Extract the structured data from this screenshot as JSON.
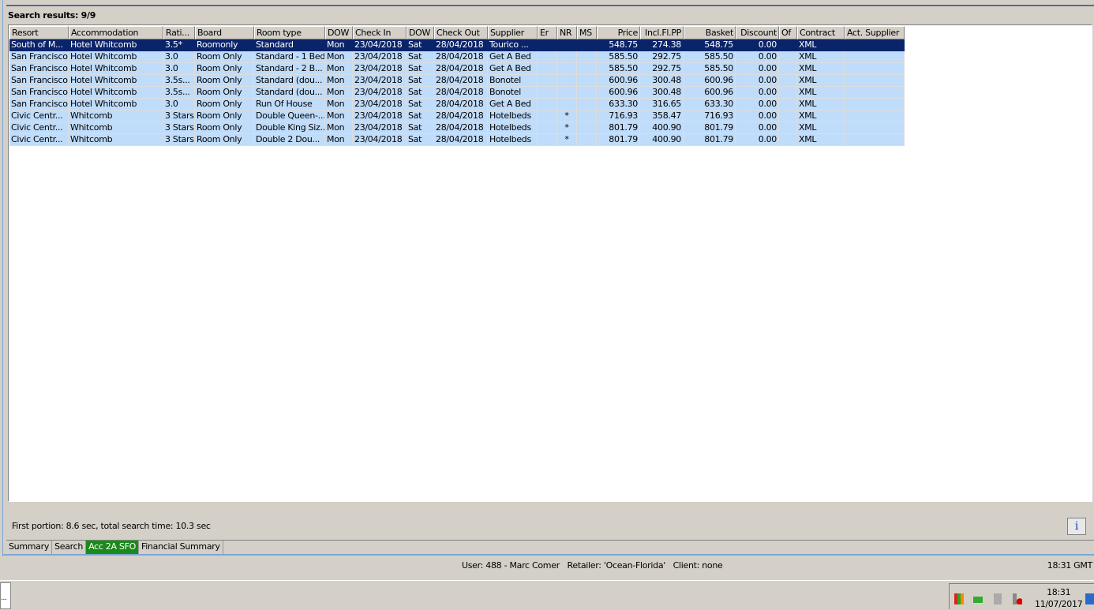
{
  "title": "Search results: 9/9",
  "columns": [
    "Resort",
    "Accommodation",
    "Rati...",
    "Board",
    "Room type",
    "DOW",
    "Check In",
    "DOW",
    "Check Out",
    "Supplier",
    "Er",
    "NR",
    "MS",
    "Price",
    "Incl.Fl.PP",
    "Basket",
    "Discount",
    "Of",
    "Contract",
    "Act. Supplier"
  ],
  "rows": [
    [
      "South of M...",
      "Hotel Whitcomb",
      "3.5*",
      "Roomonly",
      "Standard",
      "Mon",
      "23/04/2018",
      "Sat",
      "28/04/2018",
      "Tourico ...",
      "",
      "",
      "",
      "548.75",
      "274.38",
      "548.75",
      "0.00",
      "",
      "XML",
      ""
    ],
    [
      "San Francisco",
      "Hotel Whitcomb",
      "3.0",
      "Room Only",
      "Standard - 1 Bed",
      "Mon",
      "23/04/2018",
      "Sat",
      "28/04/2018",
      "Get A Bed",
      "",
      "",
      "",
      "585.50",
      "292.75",
      "585.50",
      "0.00",
      "",
      "XML",
      ""
    ],
    [
      "San Francisco",
      "Hotel Whitcomb",
      "3.0",
      "Room Only",
      "Standard - 2 B...",
      "Mon",
      "23/04/2018",
      "Sat",
      "28/04/2018",
      "Get A Bed",
      "",
      "",
      "",
      "585.50",
      "292.75",
      "585.50",
      "0.00",
      "",
      "XML",
      ""
    ],
    [
      "San Francisco",
      "Hotel Whitcomb",
      "3.5s...",
      "Room Only",
      "Standard (dou...",
      "Mon",
      "23/04/2018",
      "Sat",
      "28/04/2018",
      "Bonotel",
      "",
      "",
      "",
      "600.96",
      "300.48",
      "600.96",
      "0.00",
      "",
      "XML",
      ""
    ],
    [
      "San Francisco",
      "Hotel Whitcomb",
      "3.5s...",
      "Room Only",
      "Standard (dou...",
      "Mon",
      "23/04/2018",
      "Sat",
      "28/04/2018",
      "Bonotel",
      "",
      "",
      "",
      "600.96",
      "300.48",
      "600.96",
      "0.00",
      "",
      "XML",
      ""
    ],
    [
      "San Francisco",
      "Hotel Whitcomb",
      "3.0",
      "Room Only",
      "Run  Of House",
      "Mon",
      "23/04/2018",
      "Sat",
      "28/04/2018",
      "Get A Bed",
      "",
      "",
      "",
      "633.30",
      "316.65",
      "633.30",
      "0.00",
      "",
      "XML",
      ""
    ],
    [
      "Civic Centr...",
      "Whitcomb",
      "3 Stars",
      "Room Only",
      "Double Queen-...",
      "Mon",
      "23/04/2018",
      "Sat",
      "28/04/2018",
      "Hotelbeds",
      "",
      "*",
      "",
      "716.93",
      "358.47",
      "716.93",
      "0.00",
      "",
      "XML",
      ""
    ],
    [
      "Civic Centr...",
      "Whitcomb",
      "3 Stars",
      "Room Only",
      "Double King Siz...",
      "Mon",
      "23/04/2018",
      "Sat",
      "28/04/2018",
      "Hotelbeds",
      "",
      "*",
      "",
      "801.79",
      "400.90",
      "801.79",
      "0.00",
      "",
      "XML",
      ""
    ],
    [
      "Civic Centr...",
      "Whitcomb",
      "3 Stars",
      "Room Only",
      "Double 2  Dou...",
      "Mon",
      "23/04/2018",
      "Sat",
      "28/04/2018",
      "Hotelbeds",
      "",
      "*",
      "",
      "801.79",
      "400.90",
      "801.79",
      "0.00",
      "",
      "XML",
      ""
    ]
  ],
  "status": "First portion: 8.6 sec, total search time: 10.3 sec",
  "info_label": "i",
  "tabs": [
    "Summary",
    "Search",
    "Acc 2A SFO",
    "Financial Summary"
  ],
  "user_line": "User: 488 - Marc Comer   Retailer: 'Ocean-Florida'   Client: none",
  "app_time": "18:31 GMT",
  "taskbar": {
    "time": "18:31",
    "date": "11/07/2017",
    "left_label": "..."
  }
}
